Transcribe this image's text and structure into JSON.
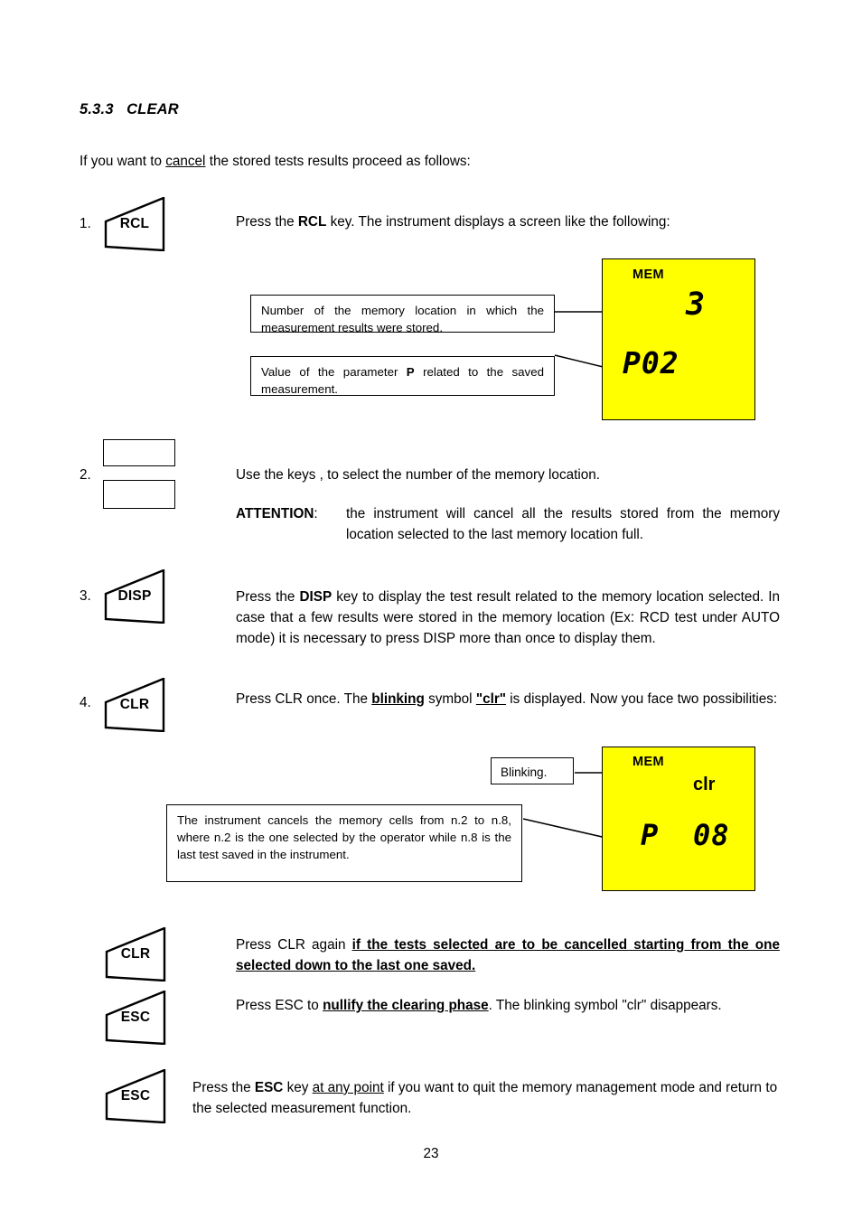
{
  "document": {
    "page_number": "23",
    "section": {
      "number": "5.3.3",
      "title": "CLEAR"
    },
    "intro": {
      "before": "If you want to ",
      "underlined": "cancel",
      "after": " the stored tests results proceed as follows:"
    }
  },
  "steps": [
    {
      "index": "1.",
      "key": "RCL",
      "text_parts": {
        "p1": "Press the ",
        "b1": "RCL",
        "p2": " key. The instrument displays a screen like the following:"
      }
    },
    {
      "index": "2.",
      "text_parts": {
        "p1": "Use the keys      ,     to select the number of the memory location."
      },
      "attention": {
        "label": "ATTENTION",
        "colon": ":",
        "text": "the instrument will cancel all the results stored from the memory location selected to the last memory location full."
      }
    },
    {
      "index": "3.",
      "key": "DISP",
      "text_parts": {
        "p1": "Press the ",
        "b1": "DISP",
        "p2": " key to display the test result related to the memory location selected. In case that a few results were stored in the memory location (Ex: RCD test under AUTO mode) it is necessary to press DISP more than once to display them."
      }
    },
    {
      "index": "4.",
      "key": "CLR",
      "text_parts": {
        "p1": "Press CLR once. The ",
        "u1": "blinking",
        "p2": " symbol ",
        "u2": "\"clr\"",
        "p3": " is displayed. Now you face two possibilities:"
      }
    }
  ],
  "outcomes": [
    {
      "key": "CLR",
      "text_parts": {
        "p1": "Press CLR again ",
        "u1": "if the tests selected are to be cancelled starting from the one selected down to the last one saved."
      }
    },
    {
      "key": "ESC",
      "text_parts": {
        "p1": "Press ESC to ",
        "u1": "nullify the clearing phase",
        "p2": ". The blinking symbol \"clr\" disappears."
      }
    }
  ],
  "final_note": {
    "key": "ESC",
    "text_parts": {
      "p1": "Press the ",
      "b1": "ESC",
      "p2": " key ",
      "u1": "at any point",
      "p3": " if you want to quit the memory management mode and return to the selected measurement function."
    }
  },
  "callouts": {
    "memory_location": "Number of the memory location in which the  measurement results were stored.",
    "parameter_value_parts": {
      "p1": "Value of the parameter ",
      "b1": "P",
      "p2": " related to the saved measurement."
    },
    "blinking": "Blinking.",
    "cancel_range": "The instrument cancels the memory cells from n.2 to n.8, where n.2 is the one selected by the operator while n.8 is the last test saved in the instrument."
  },
  "displays": [
    {
      "name": "lcd-display-rcl",
      "mem_label": "MEM",
      "memory_number": "3",
      "parameter": "P02",
      "background_color": "#FFFF00"
    },
    {
      "name": "lcd-display-clr",
      "mem_label": "MEM",
      "clr_label": "clr",
      "parameter_prefix": "P",
      "parameter_value": "08",
      "background_color": "#FFFF00"
    }
  ]
}
